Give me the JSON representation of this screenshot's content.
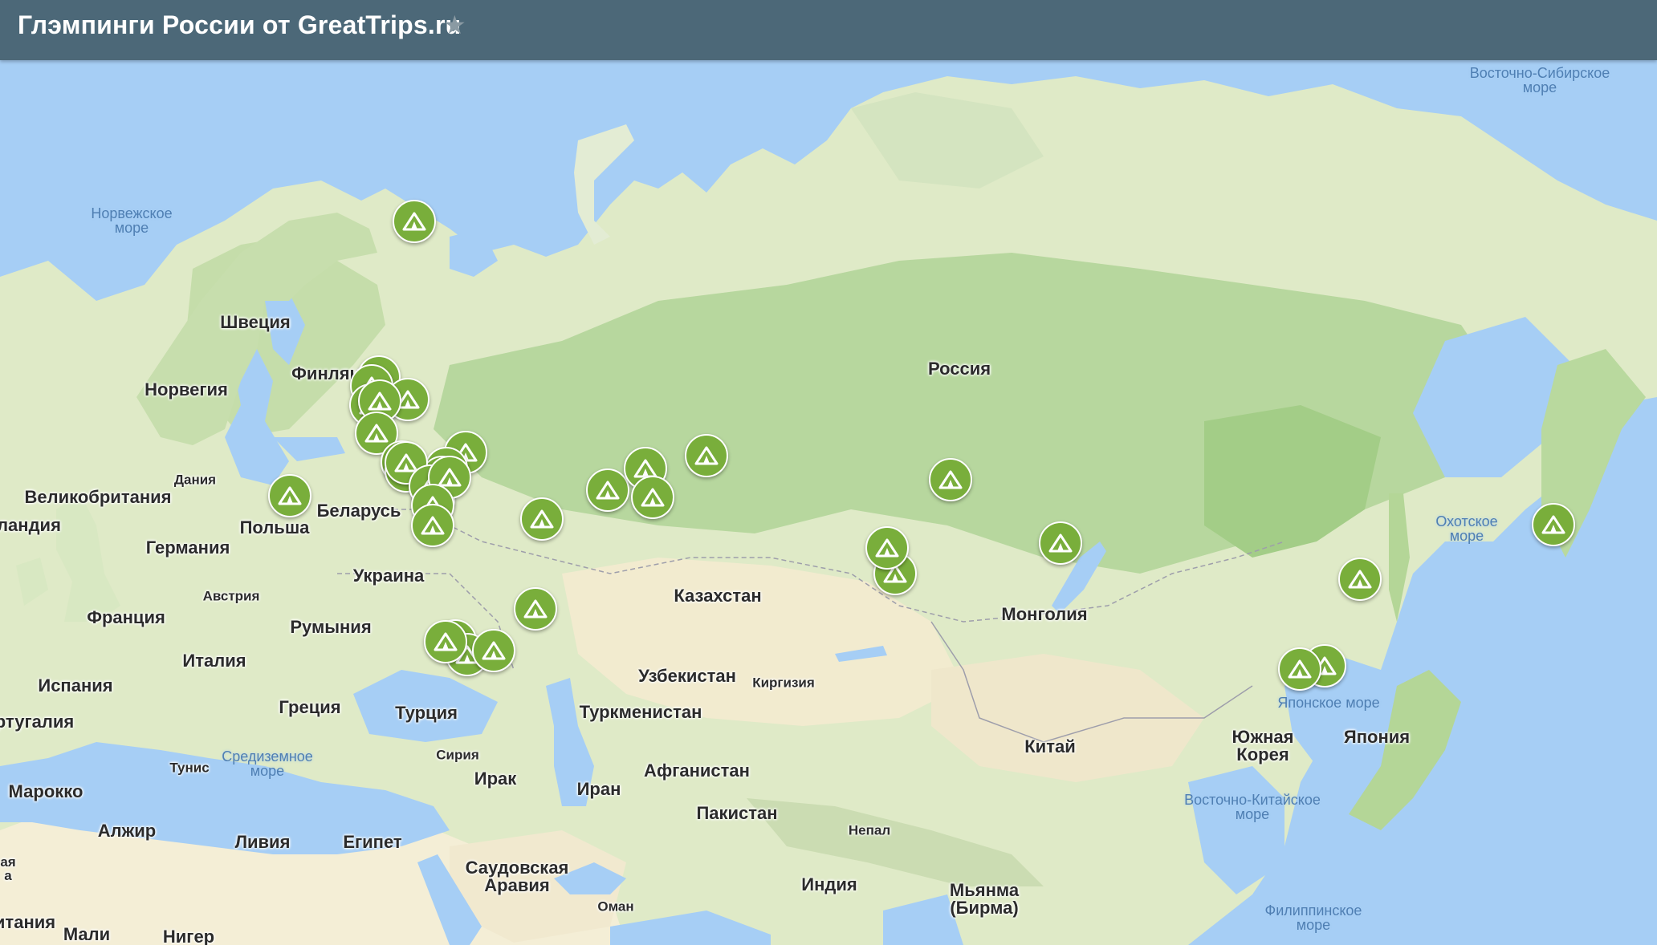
{
  "header": {
    "title": "Глэмпинги России от GreatTrips.ru",
    "star_icon": "star-icon"
  },
  "colors": {
    "header_bg": "#4c6878",
    "water": "#a6cef5",
    "land": "#dfeac7",
    "desert": "#f3ecd4",
    "forest": "#a9d08e",
    "pin": "#79ae3b"
  },
  "labels": {
    "russia": "Россия",
    "kazakhstan": "Казахстан",
    "mongolia": "Монголия",
    "china": "Китай",
    "uzbekistan": "Узбекистан",
    "turkmenistan": "Туркменистан",
    "kyrgyzstan": "Киргизия",
    "afghanistan": "Афганистан",
    "pakistan": "Пакистан",
    "iran": "Иран",
    "iraq": "Ирак",
    "syria": "Сирия",
    "turkey": "Турция",
    "saudi": "Саудовская\nАравия",
    "oman": "Оман",
    "india": "Индия",
    "nepal": "Непал",
    "myanmar": "Мьянма\n(Бирма)",
    "south_korea": "Южная\nКорея",
    "japan": "Япония",
    "sweden": "Швеция",
    "norway": "Норвегия",
    "finland": "Финлян",
    "denmark": "Дания",
    "uk": "Великобритания",
    "ireland": "ландия",
    "poland": "Польша",
    "belarus": "Беларусь",
    "germany": "Германия",
    "austria": "Австрия",
    "ukraine": "Украина",
    "france": "Франция",
    "romania": "Румыния",
    "italy": "Италия",
    "spain": "Испания",
    "portugal": "ртугалия",
    "greece": "Греция",
    "tunisia": "Тунис",
    "morocco": "Марокко",
    "algeria": "Алжир",
    "libya": "Ливия",
    "egypt": "Египет",
    "mauritania": "итания",
    "mali": "Мали",
    "niger": "Нигер",
    "west_sahara": "ая\nа",
    "sea_norwegian": "Норвежское\nморе",
    "sea_mediterranean": "Средиземное\nморе",
    "sea_okhotsk": "Охотское\nморе",
    "sea_japan": "Японское море",
    "sea_east_china": "Восточно-Китайское\nморе",
    "sea_philippine": "Филиппинское\nморе",
    "sea_east_siberian": "Восточно-Сибирское\nморе"
  },
  "markers": {
    "icon": "tent-icon",
    "count": 30
  }
}
